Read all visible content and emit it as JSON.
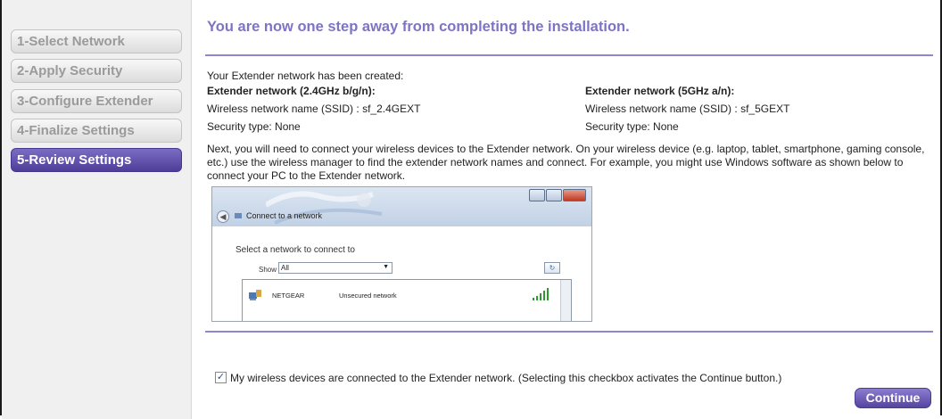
{
  "sidebar": {
    "steps": [
      {
        "label": "1-Select Network"
      },
      {
        "label": "2-Apply Security"
      },
      {
        "label": "3-Configure Extender"
      },
      {
        "label": "4-Finalize Settings"
      },
      {
        "label": "5-Review Settings",
        "active": true
      }
    ]
  },
  "main": {
    "headline": "You are now one step away from completing the installation.",
    "created_text": "Your Extender network has been created:",
    "network_24": {
      "heading": "Extender network (2.4GHz b/g/n):",
      "ssid_label": "Wireless network name (SSID) :",
      "ssid_value": "sf_2.4GEXT",
      "security": "Security type: None"
    },
    "network_5": {
      "heading": "Extender network (5GHz a/n):",
      "ssid_label": "Wireless network name (SSID) :",
      "ssid_value": "sf_5GEXT",
      "security": "Security type: None"
    },
    "instructions": "Next, you will need to connect your wireless devices to the Extender network. On your wireless device (e.g. laptop, tablet, smartphone, gaming console, etc.) use the wireless manager to find the extender network names and connect. For example, you might use Windows software as shown below to connect your PC to the Extender network.",
    "screenshot": {
      "window_title": "Connect to a network",
      "select_prompt": "Select a network to connect to",
      "show_label": "Show",
      "show_value": "All",
      "network_name": "NETGEAR",
      "network_security": "Unsecured network"
    },
    "checkbox_label": "My wireless devices are connected to the Extender network. (Selecting this checkbox activates the Continue button.)",
    "checkbox_checked": true,
    "continue_label": "Continue"
  },
  "colors": {
    "accent": "#7d74c4",
    "button": "#56449f"
  }
}
